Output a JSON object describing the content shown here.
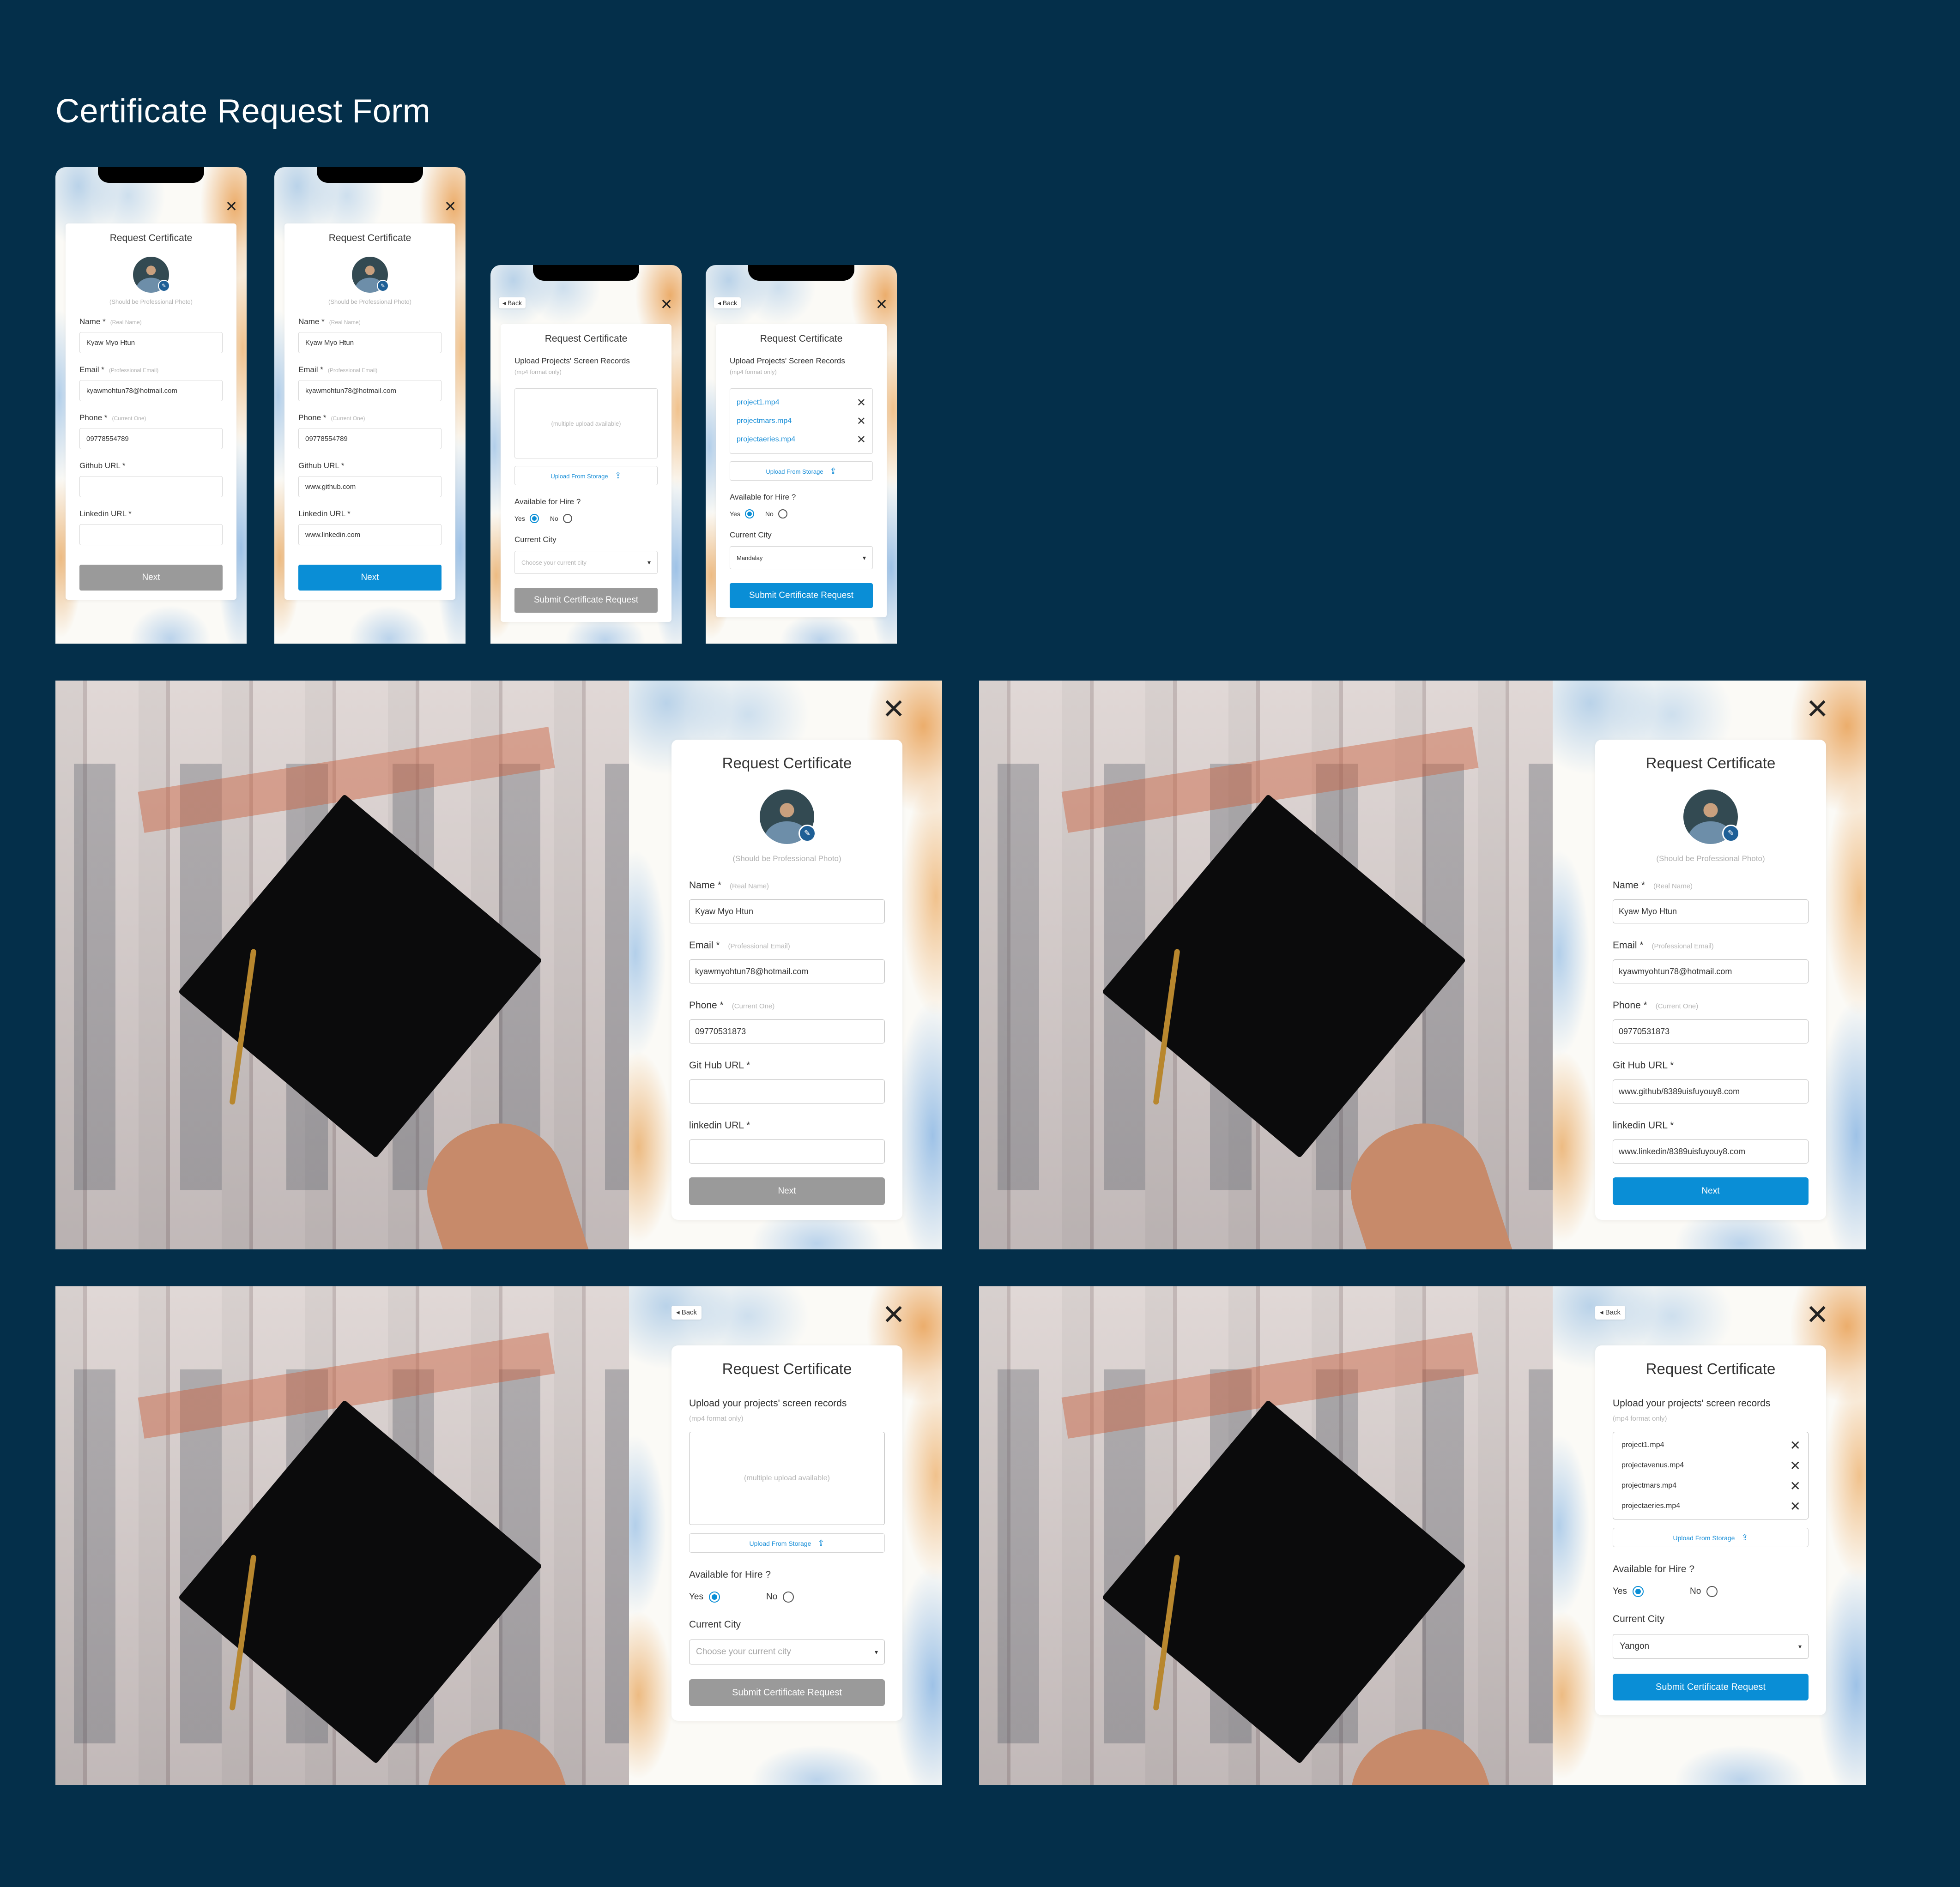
{
  "page_title": "Certificate Request Form",
  "common": {
    "card_title": "Request Certificate",
    "photo_hint": "(Should be Professional Photo)",
    "back_label": "Back",
    "close_label": "✕",
    "edit_icon": "✎",
    "upload_icon": "⇪",
    "caret": "▾",
    "remove_icon": "✕",
    "next_label": "Next",
    "submit_label": "Submit Certificate Request",
    "available_label": "Available for Hire ?",
    "yes_label": "Yes",
    "no_label": "No",
    "city_label": "Current City",
    "city_placeholder": "Choose your current city",
    "upload_from_storage": "Upload From Storage",
    "multiple_upload_hint": "(multiple upload available)",
    "mp4_hint": "(mp4 format only)"
  },
  "mobile_step1": {
    "name_label": "Name *",
    "name_hint": "(Real Name)",
    "name_value": "Kyaw Myo Htun",
    "email_label": "Email *",
    "email_hint": "(Professional Email)",
    "email_value": "kyawmohtun78@hotmail.com",
    "phone_label": "Phone *",
    "phone_hint": "(Current One)",
    "phone_value": "09778554789",
    "github_label": "Github URL *",
    "linkedin_label": "Linkedin URL *",
    "filled_github": "www.github.com",
    "filled_linkedin": "www.linkedin.com"
  },
  "mobile_step2": {
    "upload_label": "Upload Projects' Screen Records",
    "files": [
      "project1.mp4",
      "projectmars.mp4",
      "projectaeries.mp4"
    ],
    "filled_city": "Mandalay"
  },
  "desktop_step1": {
    "name_label": "Name *",
    "name_hint": "(Real Name)",
    "name_value": "Kyaw Myo Htun",
    "email_label": "Email *",
    "email_hint": "(Professional Email)",
    "email_value": "kyawmyohtun78@hotmail.com",
    "phone_label": "Phone *",
    "phone_hint": "(Current One)",
    "phone_value": "09770531873",
    "github_label": "Git Hub URL *",
    "linkedin_label": "linkedin URL *",
    "filled_github": "www.github/8389uisfuyouy8.com",
    "filled_linkedin": "www.linkedin/8389uisfuyouy8.com"
  },
  "desktop_step2": {
    "upload_label": "Upload your projects' screen records",
    "files": [
      "project1.mp4",
      "projectavenus.mp4",
      "projectmars.mp4",
      "projectaeries.mp4"
    ],
    "filled_city": "Yangon"
  },
  "colors": {
    "background": "#042f4a",
    "primary": "#0a8ed6",
    "disabled": "#9a9a9a"
  }
}
